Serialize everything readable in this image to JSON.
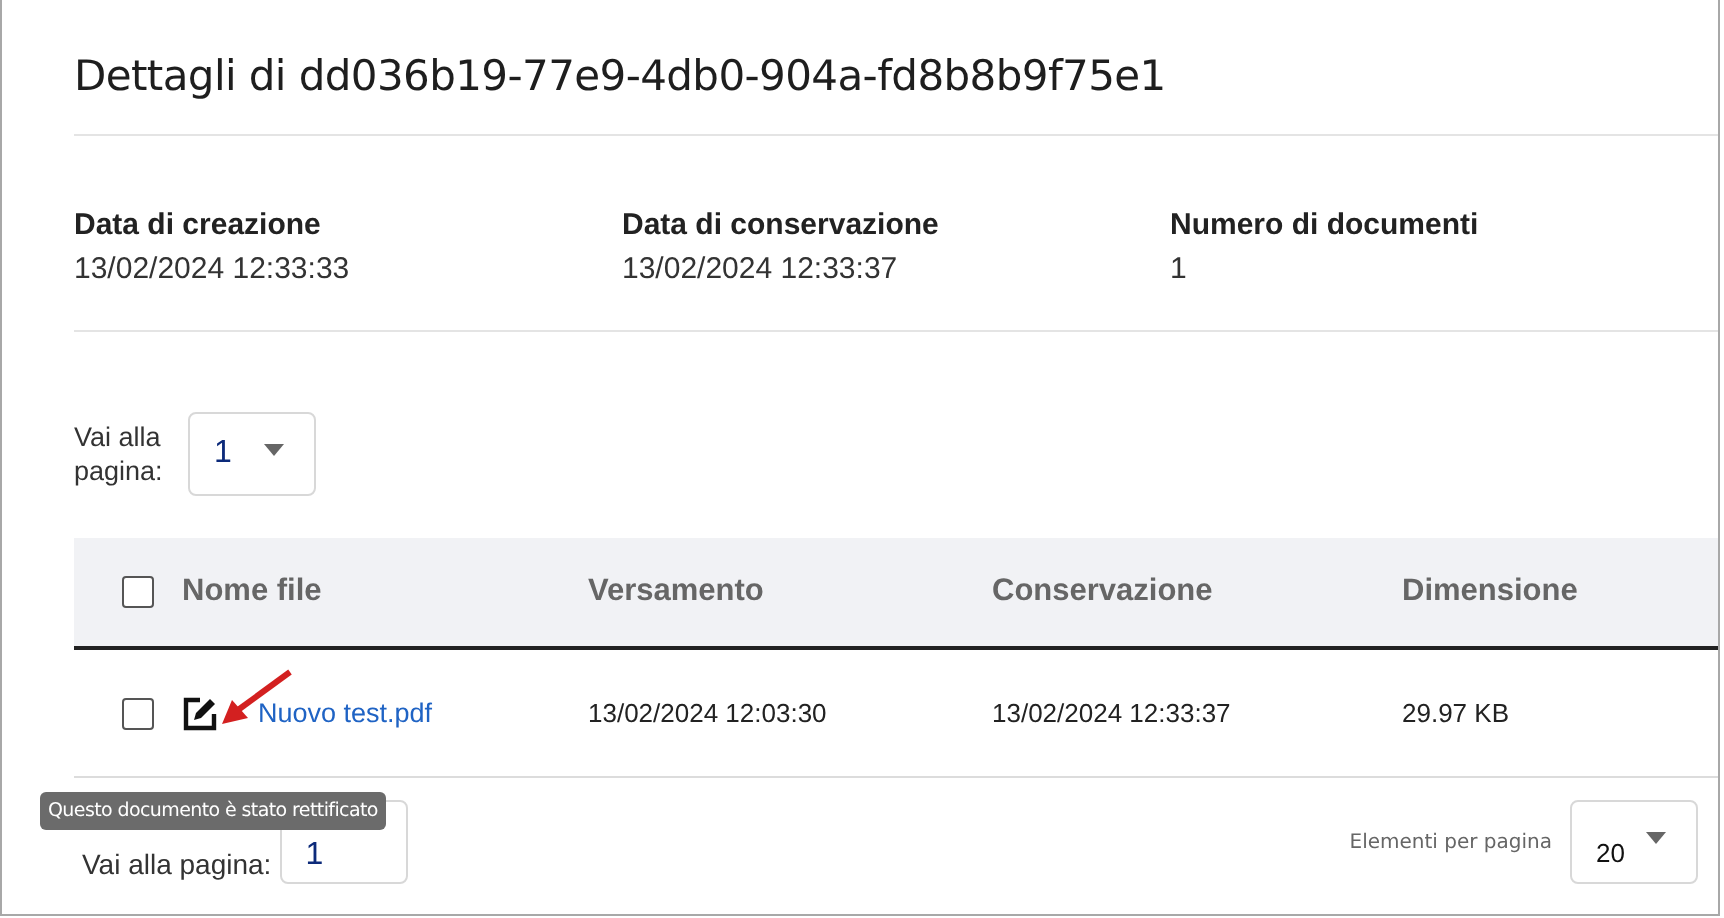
{
  "title": "Dettagli di dd036b19-77e9-4db0-904a-fd8b8b9f75e1",
  "details": [
    {
      "label": "Data di creazione",
      "value": "13/02/2024 12:33:33"
    },
    {
      "label": "Data di conservazione",
      "value": "13/02/2024 12:33:37"
    },
    {
      "label": "Numero di documenti",
      "value": "1"
    }
  ],
  "top_pager": {
    "label": "Vai alla pagina:",
    "value": "1"
  },
  "table": {
    "select_all_checked": false,
    "columns": [
      "Nome file",
      "Versamento",
      "Conservazione",
      "Dimensione"
    ],
    "rows": [
      {
        "checked": false,
        "rectified": true,
        "name": "Nuovo test.pdf",
        "versamento": "13/02/2024 12:03:30",
        "conservazione": "13/02/2024 12:33:37",
        "dimensione": "29.97 KB"
      }
    ]
  },
  "bottom_pager": {
    "label": "Vai alla pagina:",
    "value": "1",
    "per_page_label": "Elementi per pagina",
    "per_page": "20"
  },
  "tooltip": "Questo documento è stato rettificato"
}
